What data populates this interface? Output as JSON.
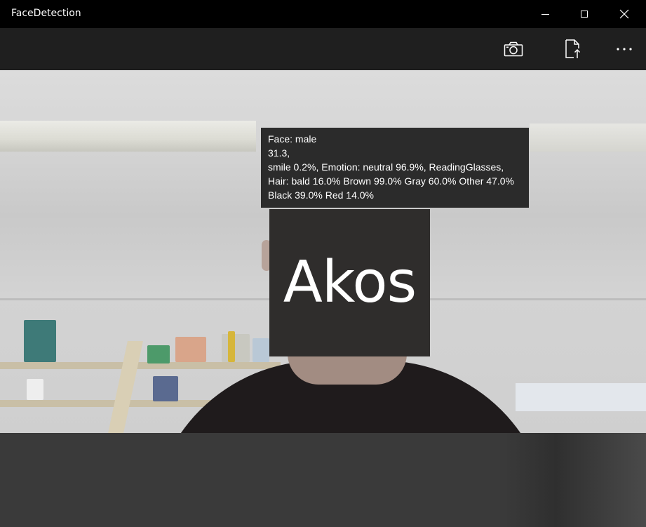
{
  "window": {
    "title": "FaceDetection",
    "controls": [
      "minimize",
      "maximize",
      "close"
    ]
  },
  "commandbar": {
    "buttons": [
      {
        "name": "camera",
        "icon": "camera-icon"
      },
      {
        "name": "upload",
        "icon": "file-upload-icon"
      },
      {
        "name": "more",
        "icon": "more-icon"
      }
    ]
  },
  "detection": {
    "label": "Akos",
    "info_lines": [
      "Face: male",
      "31.3,",
      "smile 0.2%, Emotion: neutral 96.9%, ReadingGlasses,",
      "Hair: bald 16.0% Brown 99.0% Gray 60.0% Other 47.0%",
      "Black 39.0% Red 14.0%"
    ]
  },
  "colors": {
    "titlebar": "#000000",
    "commandbar": "#1f1f1f",
    "overlay": "#2b2b2b",
    "text": "#ffffff"
  }
}
